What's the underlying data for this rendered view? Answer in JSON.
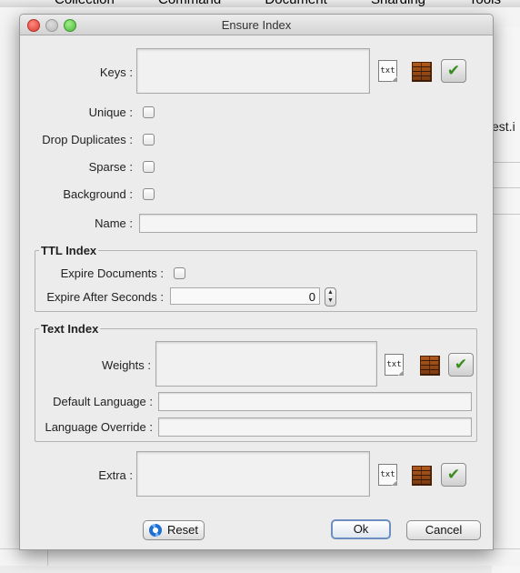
{
  "background_app": {
    "menu": [
      "Collection",
      "Command",
      "Document",
      "Sharding",
      "Tools"
    ],
    "right_text": "est.i"
  },
  "dialog": {
    "title": "Ensure Index",
    "labels": {
      "keys": "Keys :",
      "unique": "Unique :",
      "drop_duplicates": "Drop Duplicates :",
      "sparse": "Sparse :",
      "background": "Background :",
      "name": "Name :",
      "extra": "Extra :"
    },
    "ttl_index": {
      "title": "TTL Index",
      "expire_documents": "Expire Documents :",
      "expire_after_seconds": "Expire After Seconds :",
      "expire_after_seconds_value": "0"
    },
    "text_index": {
      "title": "Text Index",
      "weights": "Weights :",
      "default_language": "Default Language :",
      "language_override": "Language Override :"
    },
    "icons": {
      "txt_label": "txt",
      "check_glyph": "✔"
    },
    "buttons": {
      "reset": "Reset",
      "ok": "Ok",
      "cancel": "Cancel"
    }
  }
}
